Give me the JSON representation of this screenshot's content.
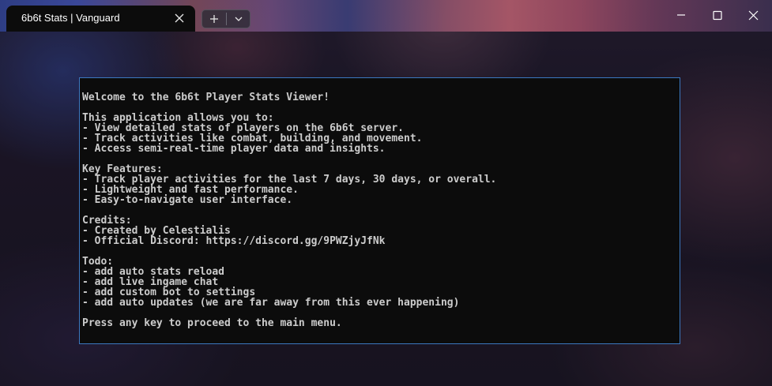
{
  "window": {
    "tab_title": "6b6t Stats | Vanguard",
    "icons": {
      "tab_close": "close-icon",
      "new_tab": "plus-icon",
      "dropdown": "chevron-down-icon",
      "minimize": "minimize-icon",
      "maximize": "maximize-icon",
      "close": "close-icon"
    }
  },
  "colors": {
    "dialog_border": "#3b78c0",
    "terminal_bg": "#0c0c0c",
    "terminal_text": "#cccccc"
  },
  "terminal": {
    "lines": [
      "Welcome to the 6b6t Player Stats Viewer!",
      "",
      "This application allows you to:",
      "- View detailed stats of players on the 6b6t server.",
      "- Track activities like combat, building, and movement.",
      "- Access semi-real-time player data and insights.",
      "",
      "Key Features:",
      "- Track player activities for the last 7 days, 30 days, or overall.",
      "- Lightweight and fast performance.",
      "- Easy-to-navigate user interface.",
      "",
      "Credits:",
      "- Created by Celestialis",
      "- Official Discord: https://discord.gg/9PWZjyJfNk",
      "",
      "Todo:",
      "- add auto stats reload",
      "- add live ingame chat",
      "- add custom bot to settings",
      "- add auto updates (we are far away from this ever happening)",
      "",
      "Press any key to proceed to the main menu."
    ]
  }
}
